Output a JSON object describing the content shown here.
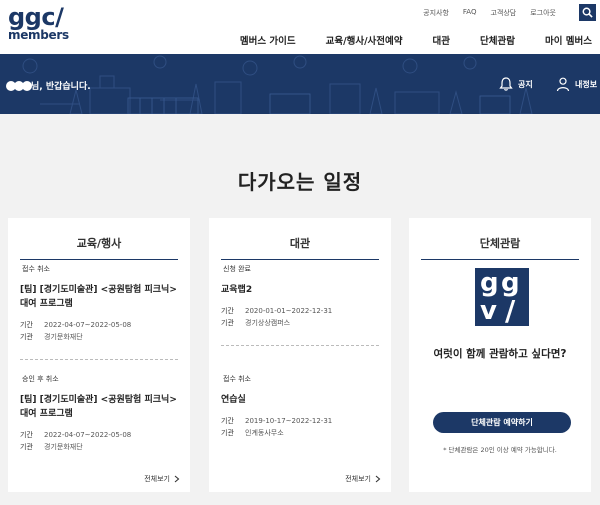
{
  "logo": {
    "line1": "ggc/",
    "line2": "members"
  },
  "util_links": [
    "공지사항",
    "FAQ",
    "고객상담",
    "로그아웃"
  ],
  "nav": [
    "멤버스 가이드",
    "교육/행사/사전예약",
    "대관",
    "단체관람",
    "마이 멤버스"
  ],
  "banner": {
    "greeting_suffix": "님, 반갑습니다.",
    "notice_label": "공지",
    "myinfo_label": "내정보"
  },
  "section_title": "다가오는 일정",
  "cards": {
    "education": {
      "title": "교육/행사",
      "items": [
        {
          "status": "접수 취소",
          "title_lines": [
            "[팀] [경기도미술관] <공원탐험 피크닉>",
            "대여 프로그램"
          ],
          "period_label": "기간",
          "period": "2022-04-07~2022-05-08",
          "org_label": "기관",
          "org": "경기문화재단"
        },
        {
          "status": "승인 후 취소",
          "title_lines": [
            "[팀] [경기도미술관] <공원탐험 피크닉>",
            "대여 프로그램"
          ],
          "period_label": "기간",
          "period": "2022-04-07~2022-05-08",
          "org_label": "기관",
          "org": "경기문화재단"
        }
      ],
      "more": "전체보기"
    },
    "rental": {
      "title": "대관",
      "items": [
        {
          "status": "신청 완료",
          "title_lines": [
            "교육랩2"
          ],
          "period_label": "기간",
          "period": "2020-01-01~2022-12-31",
          "org_label": "기관",
          "org": "경기상상캠퍼스"
        },
        {
          "status": "접수 취소",
          "title_lines": [
            "연습실"
          ],
          "period_label": "기간",
          "period": "2019-10-17~2022-12-31",
          "org_label": "기관",
          "org": "인계동사무소"
        }
      ],
      "more": "전체보기"
    },
    "group": {
      "title": "단체관람",
      "logo_text": [
        "g",
        "g",
        "v",
        "/"
      ],
      "promo": "여럿이 함께 관람하고 싶다면?",
      "button": "단체관람 예약하기",
      "note": "* 단체관람은 20인 이상 예약 가능합니다."
    }
  },
  "colors": {
    "brand": "#1c3866",
    "background": "#f2f2f2"
  }
}
